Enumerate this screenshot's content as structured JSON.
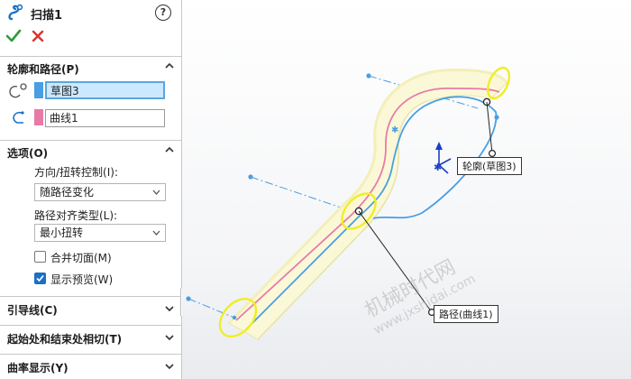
{
  "panel": {
    "title": "扫描1",
    "help_glyph": "?",
    "ok_glyph": "✔",
    "cancel_glyph": "✕",
    "profile_path": {
      "header": "轮廓和路径(P)",
      "profile_value": "草图3",
      "path_value": "曲线1",
      "profile_color": "#4a9ee3",
      "path_color": "#e87aa8"
    },
    "options": {
      "header": "选项(O)",
      "orientation_label": "方向/扭转控制(I):",
      "orientation_value": "随路径变化",
      "alignment_label": "路径对齐类型(L):",
      "alignment_value": "最小扭转",
      "merge_tangent_label": "合并切面(M)",
      "merge_tangent_checked": false,
      "show_preview_label": "显示预览(W)",
      "show_preview_checked": true
    },
    "guide_curves_header": "引导线(C)",
    "tangency_header": "起始处和结束处相切(T)",
    "curvature_header": "曲率显示(Y)"
  },
  "viewport": {
    "profile_callout": "轮廓(草图3)",
    "path_callout": "路径(曲线1)",
    "watermark_cn": "机械时代网",
    "watermark_url": "www.jxshidai.com"
  }
}
